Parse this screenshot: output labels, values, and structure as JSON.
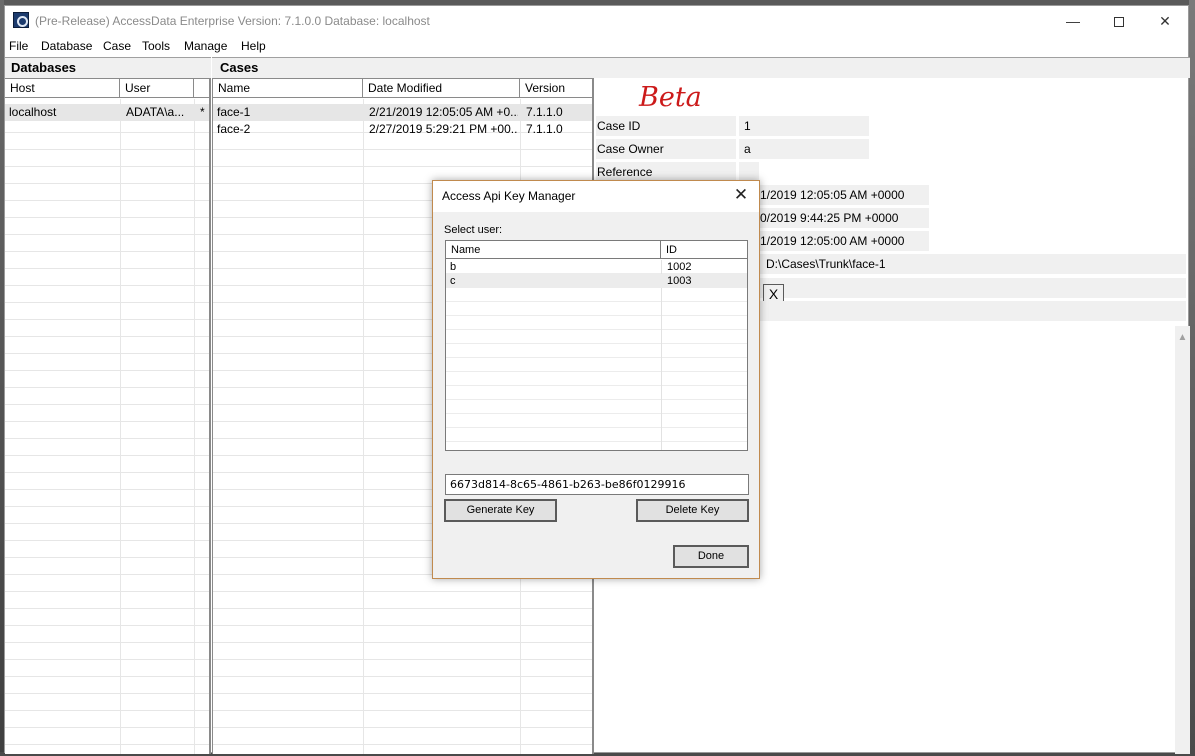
{
  "window": {
    "title": "(Pre-Release) AccessData Enterprise Version: 7.1.0.0 Database: localhost",
    "minimize_glyph": "—",
    "close_glyph": "✕"
  },
  "menu": [
    "File",
    "Database",
    "Case",
    "Tools",
    "Manage",
    "Help"
  ],
  "databases": {
    "header": "Databases",
    "columns": [
      "Host",
      "User"
    ],
    "rows": [
      {
        "host": "localhost",
        "user": "ADATA\\a...",
        "marker": "*"
      }
    ]
  },
  "cases": {
    "header": "Cases",
    "columns": [
      "Name",
      "Date Modified",
      "Version"
    ],
    "rows": [
      {
        "name": "face-1",
        "date": "2/21/2019 12:05:05 AM +0...",
        "version": "7.1.1.0"
      },
      {
        "name": "face-2",
        "date": "2/27/2019 5:29:21 PM +00...",
        "version": "7.1.1.0"
      }
    ]
  },
  "details": {
    "beta": "Beta",
    "case_id_label": "Case ID",
    "case_id_value": "1",
    "case_owner_label": "Case Owner",
    "case_owner_value": "a",
    "reference_label": "Reference",
    "date1": "1/2019 12:05:05 AM +0000",
    "date2": "0/2019 9:44:25 PM +0000",
    "date3": "1/2019 12:05:00 AM +0000",
    "path": "D:\\Cases\\Trunk\\face-1",
    "x_glyph": "X"
  },
  "dialog": {
    "title": "Access Api Key Manager",
    "close_glyph": "✕",
    "select_label": "Select user:",
    "columns": [
      "Name",
      "ID"
    ],
    "users": [
      {
        "name": "b",
        "id": "1002"
      },
      {
        "name": "c",
        "id": "1003"
      }
    ],
    "api_key": "6673d814-8c65-4861-b263-be86f0129916",
    "generate_label": "Generate Key",
    "delete_label": "Delete Key",
    "done_label": "Done"
  }
}
